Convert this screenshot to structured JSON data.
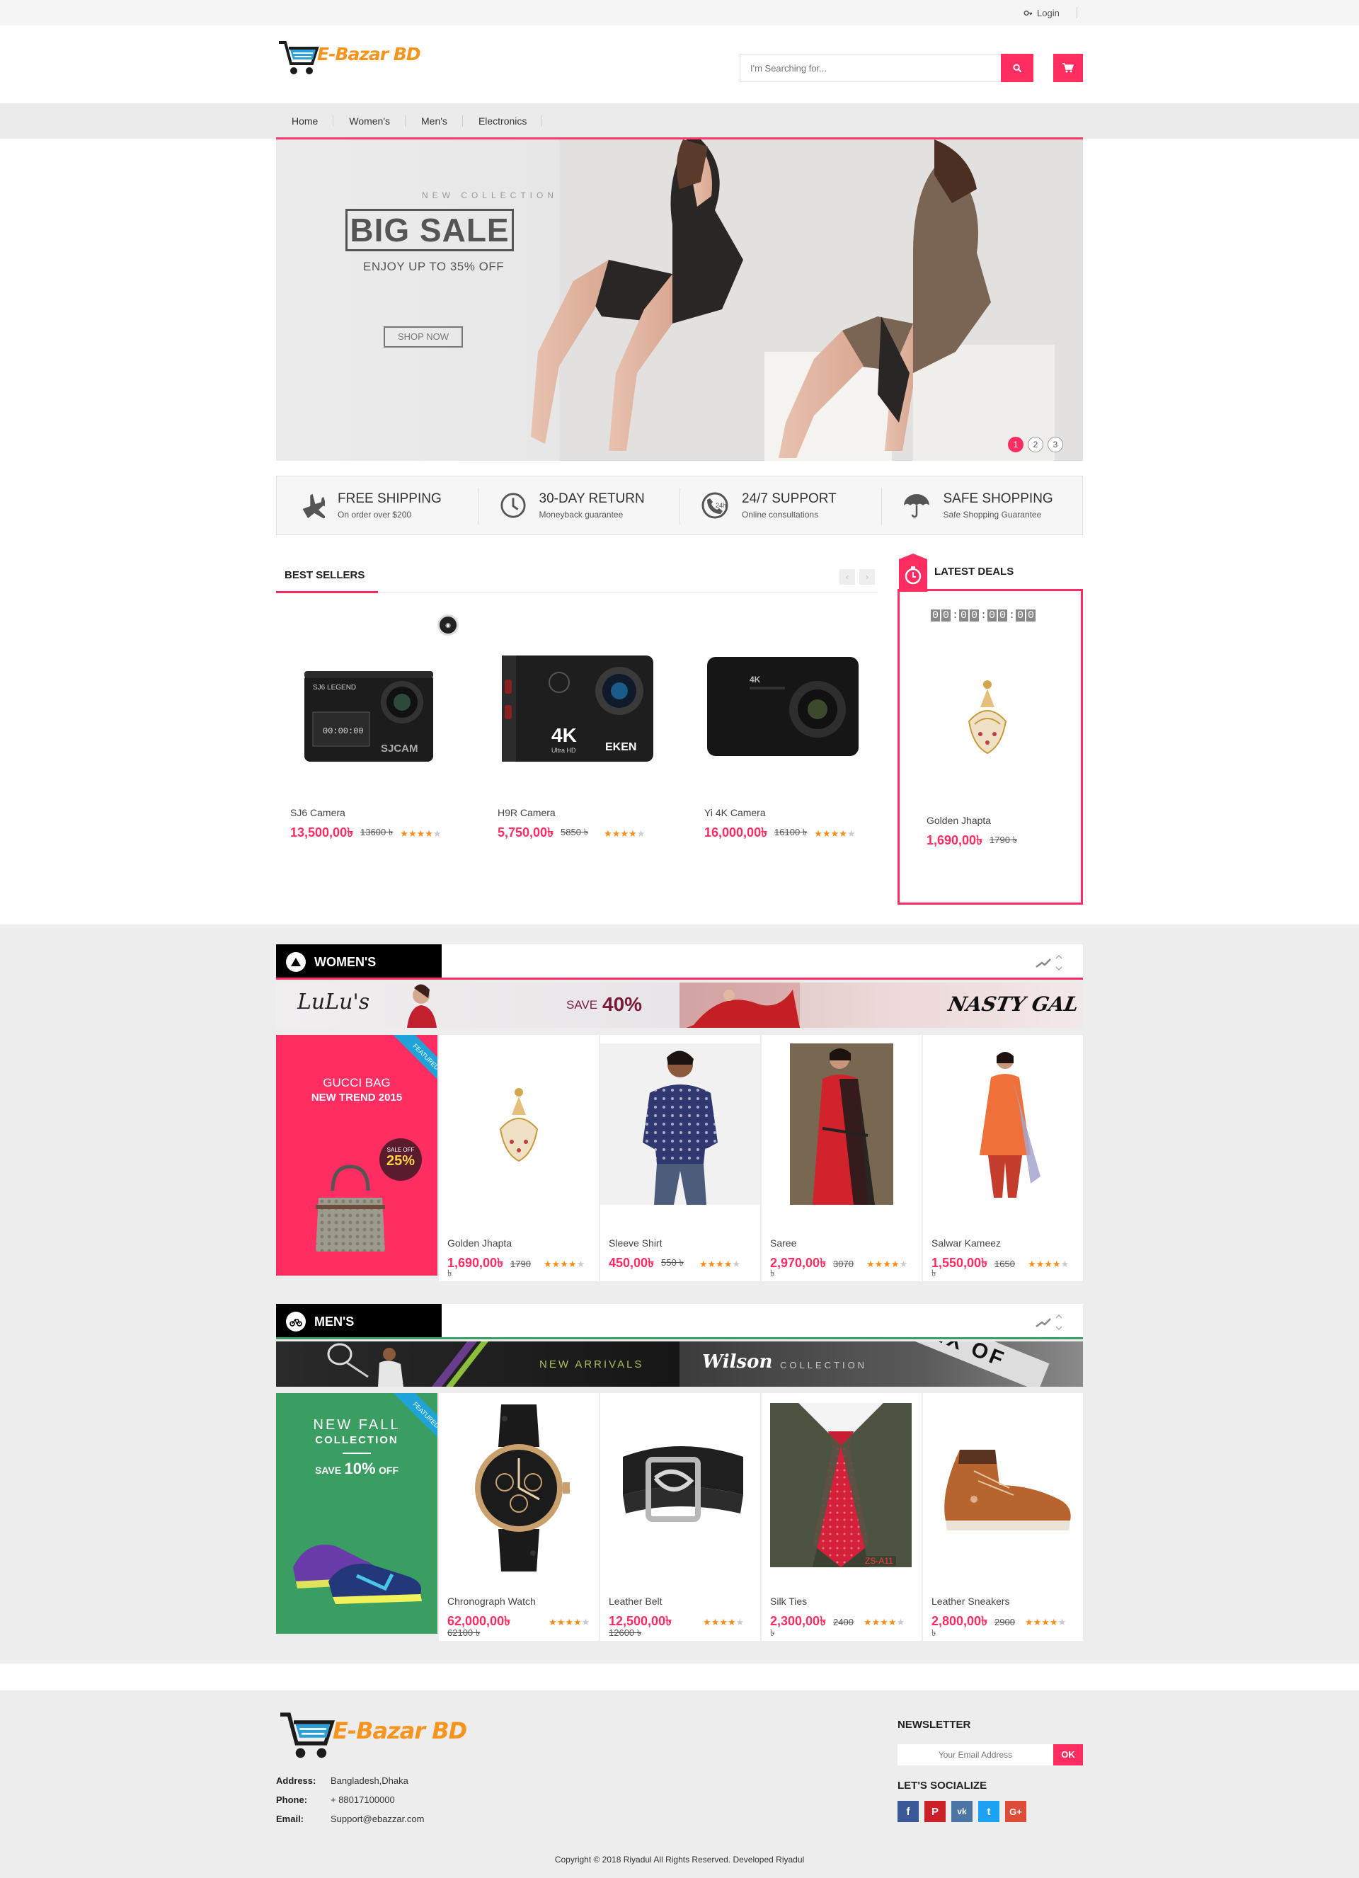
{
  "topbar": {
    "login_label": "Login"
  },
  "header": {
    "brand": "E-Bazar BD",
    "search_placeholder": "I'm Searching for..."
  },
  "nav": {
    "items": [
      "Home",
      "Women's",
      "Men's",
      "Electronics"
    ]
  },
  "hero": {
    "kicker": "NEW COLLECTION",
    "title": "BIG SALE",
    "subtitle": "ENJOY UP TO 35% OFF",
    "button": "SHOP NOW",
    "dots": [
      "1",
      "2",
      "3"
    ],
    "active_dot": 1
  },
  "features": [
    {
      "title": "FREE SHIPPING",
      "sub": "On order over $200",
      "icon": "airplane-icon"
    },
    {
      "title": "30-DAY RETURN",
      "sub": "Moneyback guarantee",
      "icon": "clock-icon"
    },
    {
      "title": "24/7 SUPPORT",
      "sub": "Online consultations",
      "icon": "support-phone-icon"
    },
    {
      "title": "SAFE SHOPPING",
      "sub": "Safe Shopping Guarantee",
      "icon": "umbrella-icon"
    }
  ],
  "best_sellers": {
    "title": "BEST SELLERS",
    "products": [
      {
        "name": "SJ6 Camera",
        "price": "13,500,00৳",
        "old": "13600 ৳",
        "rating": 4
      },
      {
        "name": "H9R Camera",
        "price": "5,750,00৳",
        "old": "5850 ৳",
        "rating": 4
      },
      {
        "name": "Yi 4K Camera",
        "price": "16,000,00৳",
        "old": "16100 ৳",
        "rating": 4
      }
    ]
  },
  "latest_deals": {
    "title": "LATEST DEALS",
    "countdown": [
      "0",
      "0",
      "0",
      "0",
      "0",
      "0",
      "0",
      "0"
    ],
    "product": {
      "name": "Golden Jhapta",
      "price": "1,690,00৳",
      "old": "1790 ৳"
    }
  },
  "womens": {
    "title": "WOMEN'S",
    "banner_left": "LuLu's",
    "banner_save": "SAVE",
    "banner_pct": "40%",
    "banner_right": "NASTY GAL",
    "promo": {
      "line1": "GUCCI BAG",
      "line2": "NEW TREND 2015",
      "badge_top": "SALE OFF",
      "badge_pct": "25%",
      "ribbon": "FEATURED"
    },
    "products": [
      {
        "name": "Golden Jhapta",
        "price": "1,690,00৳",
        "old": "1790",
        "rating": 4,
        "tail": "৳"
      },
      {
        "name": "Sleeve Shirt",
        "price": "450,00৳",
        "old": "550 ৳",
        "rating": 4,
        "tail": ""
      },
      {
        "name": "Saree",
        "price": "2,970,00৳",
        "old": "3070",
        "rating": 4,
        "tail": "৳"
      },
      {
        "name": "Salwar Kameez",
        "price": "1,550,00৳",
        "old": "1650",
        "rating": 4,
        "tail": "৳"
      }
    ]
  },
  "mens": {
    "title": "MEN'S",
    "banner_mid": "NEW ARRIVALS",
    "banner_brand": "Wilson",
    "banner_collection": "COLLECTION",
    "banner_right": "SIX OF",
    "promo": {
      "line1": "NEW FALL",
      "line2": "COLLECTION",
      "save": "SAVE",
      "pct": "10%",
      "off": "OFF",
      "ribbon": "FEATURED"
    },
    "products": [
      {
        "name": "Chronograph Watch",
        "price": "62,000,00৳",
        "old": "62100 ৳",
        "rating": 4,
        "tail": ""
      },
      {
        "name": "Leather Belt",
        "price": "12,500,00৳",
        "old": "12600 ৳",
        "rating": 4,
        "tail": ""
      },
      {
        "name": "Silk Ties",
        "price": "2,300,00৳",
        "old": "2400",
        "rating": 4,
        "tail": "৳"
      },
      {
        "name": "Leather Sneakers",
        "price": "2,800,00৳",
        "old": "2900",
        "rating": 4,
        "tail": "৳"
      }
    ],
    "tie_tag": "ZS-A11"
  },
  "footer": {
    "brand": "E-Bazar BD",
    "address_label": "Address:",
    "address": "Bangladesh,Dhaka",
    "phone_label": "Phone:",
    "phone": "+ 88017100000",
    "email_label": "Email:",
    "email": "Support@ebazzar.com",
    "newsletter_title": "NEWSLETTER",
    "newsletter_placeholder": "Your Email Address",
    "newsletter_btn": "OK",
    "social_title": "LET'S SOCIALIZE",
    "social": [
      "f",
      "P",
      "vk",
      "t",
      "G+"
    ],
    "social_colors": [
      "#3b5998",
      "#cb2027",
      "#4c75a3",
      "#1da1f2",
      "#dd4b39"
    ],
    "copyright": "Copyright © 2018 Riyadul All Rights Reserved. Developed Riyadul"
  },
  "colors": {
    "accent": "#ff2d62",
    "brand_orange": "#f7941d",
    "mens_green": "#3a9e63"
  }
}
